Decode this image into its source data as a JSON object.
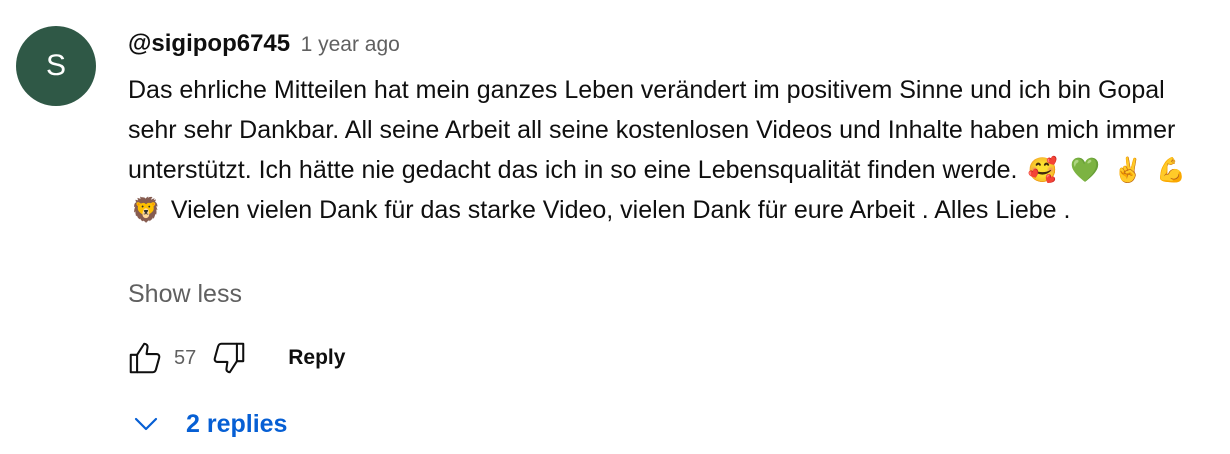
{
  "comment": {
    "avatar_letter": "S",
    "avatar_color": "#2f5846",
    "author": "@sigipop6745",
    "timestamp": "1 year ago",
    "text_part1": "Das ehrliche Mitteilen hat mein ganzes Leben verändert im positivem Sinne und ich bin Gopal sehr sehr Dankbar. All seine Arbeit all seine kostenlosen Videos und Inhalte haben mich immer unterstützt. Ich hätte nie gedacht das ich in so eine Lebensqualität finden werde.",
    "emojis": [
      "🥰",
      "💚",
      "✌️",
      "💪",
      "🦁"
    ],
    "text_part2": "Vielen vielen Dank für das starke Video, vielen Dank für eure Arbeit . Alles Liebe .",
    "show_less_label": "Show less",
    "like_count": "57",
    "reply_label": "Reply",
    "replies_label": "2 replies",
    "link_color": "#065fd4"
  }
}
